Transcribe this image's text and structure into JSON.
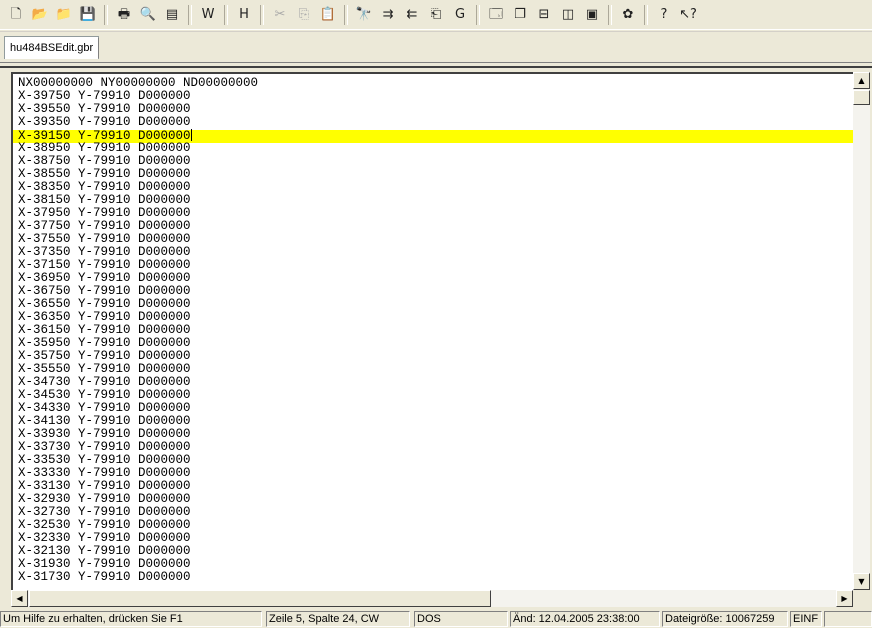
{
  "toolbar": {
    "buttons": [
      {
        "icon": "new-file-icon",
        "glyph": "🗋"
      },
      {
        "icon": "open-folder-icon",
        "glyph": "📂"
      },
      {
        "icon": "open-folder-dark-icon",
        "glyph": "📁"
      },
      {
        "icon": "save-disk-icon",
        "glyph": "💾"
      },
      {
        "icon": "print-icon",
        "glyph": "🖶"
      },
      {
        "icon": "print-preview-icon",
        "glyph": "🔍"
      },
      {
        "icon": "page-setup-icon",
        "glyph": "▤"
      },
      {
        "icon": "word-wrap-icon",
        "glyph": "W"
      },
      {
        "icon": "hex-mode-icon",
        "glyph": "H"
      },
      {
        "icon": "cut-icon",
        "glyph": "✂"
      },
      {
        "icon": "copy-icon",
        "glyph": "⎘"
      },
      {
        "icon": "paste-icon",
        "glyph": "📋"
      },
      {
        "icon": "find-icon",
        "glyph": "🔭"
      },
      {
        "icon": "find-next-icon",
        "glyph": "⇉"
      },
      {
        "icon": "find-previous-icon",
        "glyph": "⇇"
      },
      {
        "icon": "replace-icon",
        "glyph": "⎗"
      },
      {
        "icon": "goto-icon",
        "glyph": "G"
      },
      {
        "icon": "new-window-icon",
        "glyph": "🗔"
      },
      {
        "icon": "cascade-icon",
        "glyph": "❐"
      },
      {
        "icon": "tile-horizontal-icon",
        "glyph": "⊟"
      },
      {
        "icon": "tile-vertical-icon",
        "glyph": "◫"
      },
      {
        "icon": "arrange-icon",
        "glyph": "▣"
      },
      {
        "icon": "macro-icon",
        "glyph": "✿"
      },
      {
        "icon": "help-icon",
        "glyph": "?"
      },
      {
        "icon": "context-help-icon",
        "glyph": "↖?"
      }
    ]
  },
  "tab": {
    "label": "hu484BSEdit.gbr"
  },
  "editor": {
    "lines": [
      "NX00000000 NY00000000 ND00000000",
      "X-39750 Y-79910 D000000",
      "X-39550 Y-79910 D000000",
      "X-39350 Y-79910 D000000",
      "X-39150 Y-79910 D000000",
      "X-38950 Y-79910 D000000",
      "X-38750 Y-79910 D000000",
      "X-38550 Y-79910 D000000",
      "X-38350 Y-79910 D000000",
      "X-38150 Y-79910 D000000",
      "X-37950 Y-79910 D000000",
      "X-37750 Y-79910 D000000",
      "X-37550 Y-79910 D000000",
      "X-37350 Y-79910 D000000",
      "X-37150 Y-79910 D000000",
      "X-36950 Y-79910 D000000",
      "X-36750 Y-79910 D000000",
      "X-36550 Y-79910 D000000",
      "X-36350 Y-79910 D000000",
      "X-36150 Y-79910 D000000",
      "X-35950 Y-79910 D000000",
      "X-35750 Y-79910 D000000",
      "X-35550 Y-79910 D000000",
      "X-34730 Y-79910 D000000",
      "X-34530 Y-79910 D000000",
      "X-34330 Y-79910 D000000",
      "X-34130 Y-79910 D000000",
      "X-33930 Y-79910 D000000",
      "X-33730 Y-79910 D000000",
      "X-33530 Y-79910 D000000",
      "X-33330 Y-79910 D000000",
      "X-33130 Y-79910 D000000",
      "X-32930 Y-79910 D000000",
      "X-32730 Y-79910 D000000",
      "X-32530 Y-79910 D000000",
      "X-32330 Y-79910 D000000",
      "X-32130 Y-79910 D000000",
      "X-31930 Y-79910 D000000",
      "X-31730 Y-79910 D000000"
    ],
    "highlight_color": "#ffff00"
  },
  "statusbar": {
    "help": "Um Hilfe zu erhalten, drücken Sie F1",
    "position": "Zeile 5, Spalte 24, CW",
    "format": "DOS",
    "modified": "Änd: 12.04.2005 23:38:00",
    "filesize": "Dateigröße: 10067259",
    "mode": "EINF"
  }
}
